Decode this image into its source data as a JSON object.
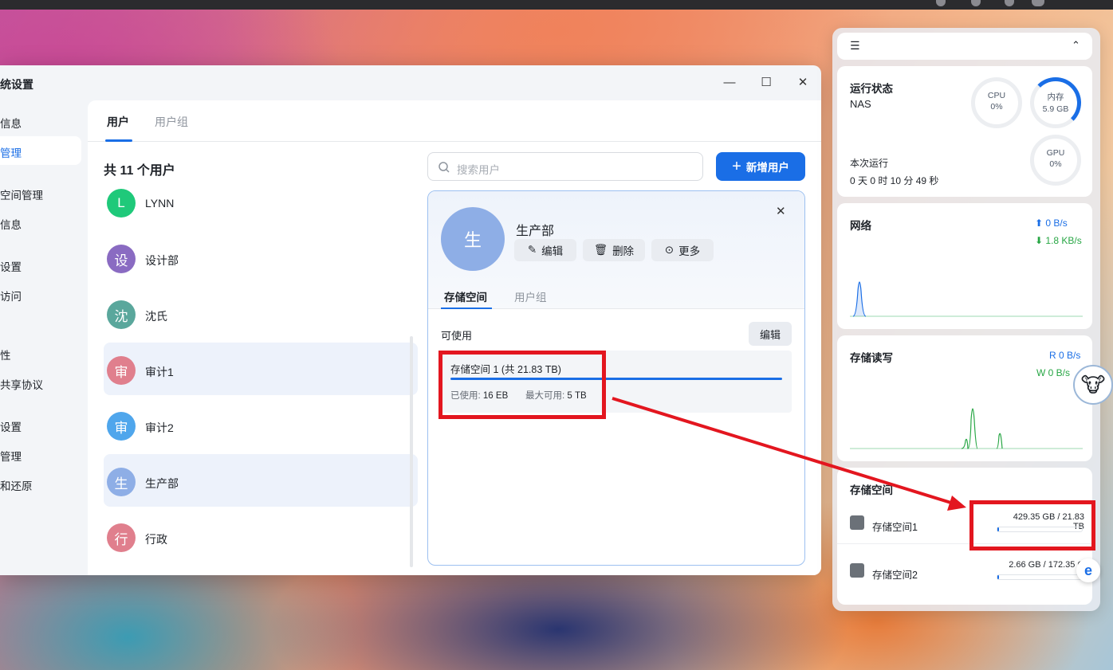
{
  "window": {
    "title_fragment": "统设置",
    "minimize": "—",
    "maximize": "☐",
    "close": "✕"
  },
  "sidebar": {
    "items": [
      {
        "label": "信息"
      },
      {
        "label": "管理"
      },
      {
        "label": "空间管理"
      },
      {
        "label": "信息"
      },
      {
        "label": "设置"
      },
      {
        "label": "访问"
      },
      {
        "label": "性"
      },
      {
        "label": "共享协议"
      },
      {
        "label": "设置"
      },
      {
        "label": "管理"
      },
      {
        "label": "和还原"
      }
    ]
  },
  "tabs": [
    {
      "label": "用户"
    },
    {
      "label": "用户组"
    }
  ],
  "user_list": {
    "count_label": "共 11 个用户",
    "users": [
      {
        "initial": "L",
        "name": "LYNN",
        "color": "#1fc97a"
      },
      {
        "initial": "设",
        "name": "设计部",
        "color": "#8a6bc2"
      },
      {
        "initial": "沈",
        "name": "沈氏",
        "color": "#5aa79c"
      },
      {
        "initial": "审",
        "name": "审计1",
        "color": "#e07f8d"
      },
      {
        "initial": "审",
        "name": "审计2",
        "color": "#4fa6ec"
      },
      {
        "initial": "生",
        "name": "生产部",
        "color": "#8eaee6"
      },
      {
        "initial": "行",
        "name": "行政",
        "color": "#e07f8d"
      }
    ]
  },
  "search": {
    "placeholder": "搜索用户"
  },
  "add_user_label": "新增用户",
  "detail": {
    "initial": "生",
    "name": "生产部",
    "edit_label": "编辑",
    "delete_label": "删除",
    "more_label": "更多",
    "tab_storage": "存储空间",
    "tab_groups": "用户组",
    "available_label": "可使用",
    "edit_quota_label": "编辑",
    "storage_title": "存储空间 1 (共 21.83 TB)",
    "used_label": "已使用:",
    "used_value": "16 EB",
    "max_label": "最大可用:",
    "max_value": "5 TB"
  },
  "widgets": {
    "status": {
      "title": "运行状态",
      "device": "NAS",
      "cpu_label": "CPU",
      "cpu_value": "0%",
      "mem_label": "内存",
      "mem_value": "5.9 GB",
      "gpu_label": "GPU",
      "gpu_value": "0%",
      "uptime_label": "本次运行",
      "uptime_value": "0 天 0 时 10 分 49 秒"
    },
    "network": {
      "title": "网络",
      "up": "0 B/s",
      "down": "1.8 KB/s"
    },
    "disk_io": {
      "title": "存储读写",
      "read": "R 0 B/s",
      "write": "W 0 B/s"
    },
    "storage": {
      "title": "存储空间",
      "volumes": [
        {
          "name": "存储空间1",
          "size": "429.35 GB / 21.83 TB",
          "fraction": 0.02
        },
        {
          "name": "存储空间2",
          "size": "2.66 GB / 172.35 G",
          "fraction": 0.02
        }
      ]
    }
  },
  "colors": {
    "accent": "#1a6ee6",
    "annotation": "#e3161f"
  }
}
